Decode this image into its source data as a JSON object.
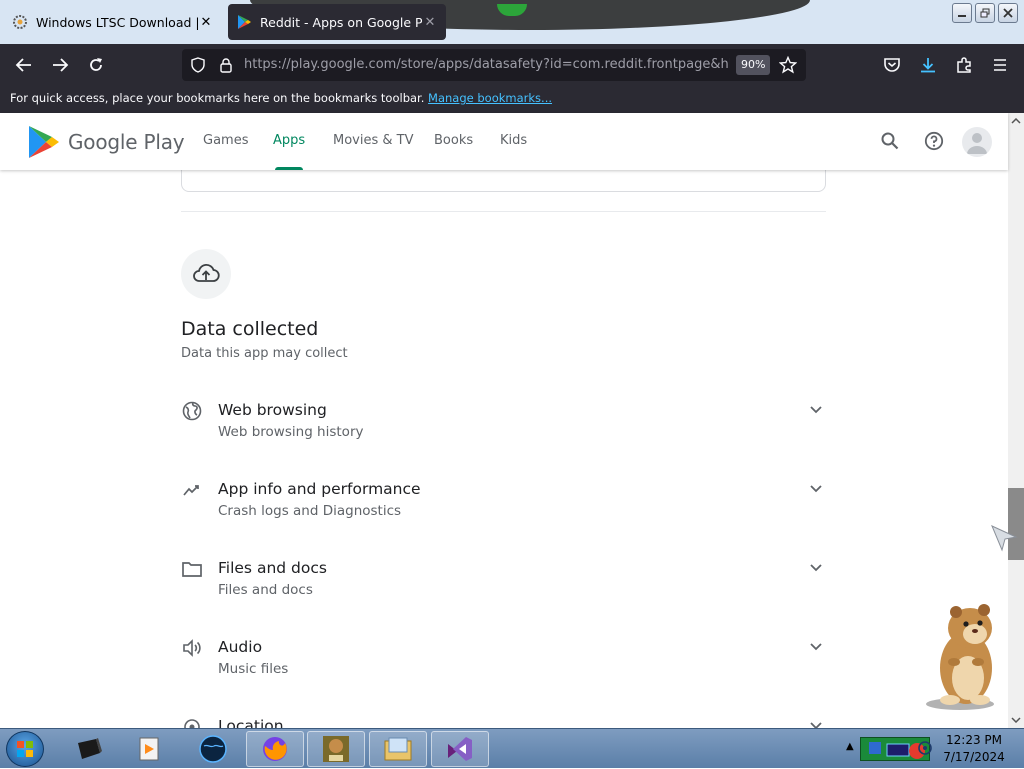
{
  "browser": {
    "tabs": [
      {
        "title": "Windows LTSC Download | MAS",
        "active": false
      },
      {
        "title": "Reddit - Apps on Google Play",
        "active": true
      }
    ],
    "url": "https://play.google.com/store/apps/datasafety?id=com.reddit.frontpage&hl=en",
    "zoom": "90%",
    "bookmarks_message": "For quick access, place your bookmarks here on the bookmarks toolbar.",
    "bookmarks_link": "Manage bookmarks..."
  },
  "play": {
    "brand": "Google Play",
    "nav": [
      "Games",
      "Apps",
      "Movies & TV",
      "Books",
      "Kids"
    ],
    "active_nav": "Apps",
    "accent": "#01875f"
  },
  "section": {
    "title": "Data collected",
    "subtitle": "Data this app may collect",
    "icon": "cloud-upload-icon"
  },
  "rows": [
    {
      "title": "Web browsing",
      "subtitle": "Web browsing history",
      "icon": "globe-icon"
    },
    {
      "title": "App info and performance",
      "subtitle": "Crash logs and Diagnostics",
      "icon": "performance-icon"
    },
    {
      "title": "Files and docs",
      "subtitle": "Files and docs",
      "icon": "folder-icon"
    },
    {
      "title": "Audio",
      "subtitle": "Music files",
      "icon": "audio-icon"
    },
    {
      "title": "Location",
      "subtitle": "",
      "icon": "location-icon"
    }
  ],
  "taskbar": {
    "time": "12:23 PM",
    "date": "7/17/2024"
  }
}
